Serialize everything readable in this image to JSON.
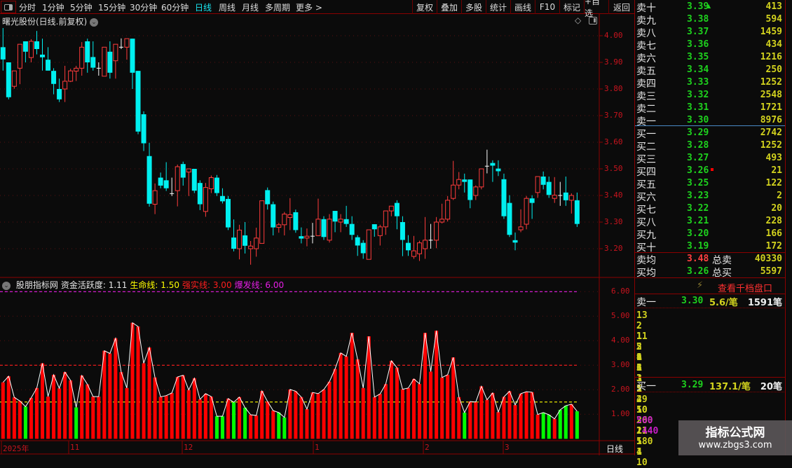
{
  "toolbar": {
    "periods": [
      "分时",
      "1分钟",
      "5分钟",
      "15分钟",
      "30分钟",
      "60分钟",
      "日线",
      "周线",
      "月线",
      "多周期",
      "更多 >"
    ],
    "active_period": "日线",
    "buttons": [
      "复权",
      "叠加",
      "多股",
      "统计",
      "画线",
      "F10",
      "标记",
      "+自选",
      "返回"
    ]
  },
  "chart": {
    "title": "曙光股份(日线.前复权)",
    "price_ticks": [
      "4.00",
      "3.90",
      "3.80",
      "3.70",
      "3.60",
      "3.50",
      "3.40",
      "3.30",
      "3.20"
    ],
    "colors": {
      "up": "#ff3c3c",
      "down": "#00f0f0",
      "doji": "#ffffff",
      "axis": "#c8141e",
      "grid": "#5a1010"
    }
  },
  "chart_data": [
    {
      "type": "candlestick",
      "ylim": [
        3.15,
        4.03
      ],
      "ohlc": [
        [
          3.957,
          4.029,
          3.869,
          3.911
        ],
        [
          3.9,
          3.9,
          3.761,
          3.769
        ],
        [
          3.81,
          3.868,
          3.801,
          3.868
        ],
        [
          3.878,
          3.968,
          3.818,
          3.968
        ],
        [
          3.979,
          3.979,
          3.9,
          3.94
        ],
        [
          3.918,
          3.987,
          3.9,
          3.979
        ],
        [
          3.979,
          4.018,
          3.93,
          3.95
        ],
        [
          3.929,
          3.989,
          3.869,
          3.919
        ],
        [
          3.91,
          3.957,
          3.869,
          3.869
        ],
        [
          3.868,
          3.878,
          3.78,
          3.819
        ],
        [
          3.8,
          3.839,
          3.751,
          3.761
        ],
        [
          3.8,
          3.887,
          3.751,
          3.829
        ],
        [
          3.829,
          3.876,
          3.826,
          3.868
        ],
        [
          3.867,
          3.887,
          3.83,
          3.878
        ],
        [
          3.878,
          3.976,
          3.85,
          3.957
        ],
        [
          3.979,
          3.989,
          3.861,
          3.9
        ],
        [
          3.92,
          3.979,
          3.869,
          3.88
        ],
        [
          3.878,
          3.9,
          3.85,
          3.878
        ],
        [
          3.848,
          3.957,
          3.848,
          3.957
        ],
        [
          3.94,
          3.979,
          3.839,
          3.861
        ],
        [
          3.906,
          3.968,
          3.839,
          3.968
        ],
        [
          3.957,
          3.99,
          3.95,
          3.957
        ],
        [
          3.957,
          3.989,
          3.91,
          3.989
        ],
        [
          3.989,
          3.989,
          3.8,
          3.861
        ],
        [
          3.868,
          3.868,
          3.63,
          3.64
        ],
        [
          3.705,
          3.716,
          3.567,
          3.596
        ],
        [
          3.548,
          3.598,
          3.358,
          3.369
        ],
        [
          3.367,
          3.445,
          3.33,
          3.418
        ],
        [
          3.467,
          3.486,
          3.427,
          3.437
        ],
        [
          3.457,
          3.525,
          3.417,
          3.427
        ],
        [
          3.407,
          3.467,
          3.398,
          3.407
        ],
        [
          3.418,
          3.516,
          3.359,
          3.508
        ],
        [
          3.518,
          3.527,
          3.437,
          3.467
        ],
        [
          3.488,
          3.5,
          3.398,
          3.5
        ],
        [
          3.5,
          3.5,
          3.409,
          3.418
        ],
        [
          3.447,
          3.457,
          3.345,
          3.367
        ],
        [
          3.34,
          3.447,
          3.32,
          3.43
        ],
        [
          3.425,
          3.475,
          3.409,
          3.467
        ],
        [
          3.467,
          3.477,
          3.398,
          3.409
        ],
        [
          3.398,
          3.427,
          3.37,
          3.378
        ],
        [
          3.387,
          3.398,
          3.27,
          3.28
        ],
        [
          3.242,
          3.31,
          3.19,
          3.2
        ],
        [
          3.2,
          3.29,
          3.16,
          3.27
        ],
        [
          3.25,
          3.3,
          3.182,
          3.211
        ],
        [
          3.2,
          3.229,
          3.14,
          3.21
        ],
        [
          3.2,
          3.279,
          3.17,
          3.24
        ],
        [
          3.22,
          3.38,
          3.22,
          3.38
        ],
        [
          3.42,
          3.43,
          3.347,
          3.367
        ],
        [
          3.367,
          3.377,
          3.25,
          3.28
        ],
        [
          3.28,
          3.297,
          3.26,
          3.29
        ],
        [
          3.29,
          3.338,
          3.25,
          3.33
        ],
        [
          3.317,
          3.39,
          3.27,
          3.328
        ],
        [
          3.337,
          3.347,
          3.26,
          3.27
        ],
        [
          3.247,
          3.28,
          3.22,
          3.238
        ],
        [
          3.24,
          3.276,
          3.209,
          3.247
        ],
        [
          3.247,
          3.297,
          3.22,
          3.247
        ],
        [
          3.249,
          3.388,
          3.249,
          3.311
        ],
        [
          3.311,
          3.322,
          3.233,
          3.244
        ],
        [
          3.232,
          3.33,
          3.223,
          3.311
        ],
        [
          3.342,
          3.342,
          3.262,
          3.302
        ],
        [
          3.3,
          3.33,
          3.262,
          3.311
        ],
        [
          3.311,
          3.361,
          3.282,
          3.293
        ],
        [
          3.293,
          3.322,
          3.233,
          3.252
        ],
        [
          3.243,
          3.251,
          3.173,
          3.212
        ],
        [
          3.222,
          3.232,
          3.162,
          3.183
        ],
        [
          3.16,
          3.271,
          3.16,
          3.271
        ],
        [
          3.292,
          3.292,
          3.245,
          3.273
        ],
        [
          3.249,
          3.29,
          3.212,
          3.282
        ],
        [
          3.282,
          3.342,
          3.252,
          3.342
        ],
        [
          3.342,
          3.36,
          3.322,
          3.36
        ],
        [
          3.372,
          3.382,
          3.273,
          3.322
        ],
        [
          3.3,
          3.322,
          3.172,
          3.233
        ],
        [
          3.222,
          3.251,
          3.173,
          3.194
        ],
        [
          3.171,
          3.248,
          3.162,
          3.192
        ],
        [
          3.181,
          3.23,
          3.154,
          3.222
        ],
        [
          3.2,
          3.319,
          3.162,
          3.232
        ],
        [
          3.232,
          3.293,
          3.2,
          3.232
        ],
        [
          3.232,
          3.319,
          3.202,
          3.3
        ],
        [
          3.3,
          3.369,
          3.295,
          3.311
        ],
        [
          3.311,
          3.398,
          3.302,
          3.382
        ],
        [
          3.389,
          3.53,
          3.383,
          3.439
        ],
        [
          3.439,
          3.488,
          3.423,
          3.46
        ],
        [
          3.46,
          3.482,
          3.411,
          3.451
        ],
        [
          3.46,
          3.46,
          3.352,
          3.383
        ],
        [
          3.4,
          3.438,
          3.383,
          3.432
        ],
        [
          3.432,
          3.5,
          3.423,
          3.5
        ],
        [
          3.51,
          3.572,
          3.483,
          3.51
        ],
        [
          3.522,
          3.532,
          3.451,
          3.512
        ],
        [
          3.501,
          3.532,
          3.473,
          3.491
        ],
        [
          3.461,
          3.482,
          3.312,
          3.322
        ],
        [
          3.372,
          3.401,
          3.244,
          3.252
        ],
        [
          3.232,
          3.261,
          3.194,
          3.223
        ],
        [
          3.271,
          3.348,
          3.262,
          3.282
        ],
        [
          3.292,
          3.398,
          3.273,
          3.389
        ],
        [
          3.389,
          3.401,
          3.312,
          3.372
        ],
        [
          3.411,
          3.471,
          3.391,
          3.471
        ],
        [
          3.471,
          3.49,
          3.423,
          3.44
        ],
        [
          3.451,
          3.471,
          3.391,
          3.402
        ],
        [
          3.389,
          3.469,
          3.372,
          3.401
        ],
        [
          3.4,
          3.451,
          3.361,
          3.4
        ],
        [
          3.411,
          3.471,
          3.361,
          3.382
        ],
        [
          3.382,
          3.408,
          3.332,
          3.4
        ],
        [
          3.382,
          3.411,
          3.282,
          3.293
        ]
      ]
    },
    {
      "type": "bar",
      "ylim": [
        0,
        6.3
      ],
      "y_ticks": [
        "6.00",
        "5.00",
        "4.00",
        "3.00",
        "2.00",
        "1.00"
      ],
      "values": [
        2.3,
        2.55,
        1.69,
        1.54,
        1.31,
        1.67,
        2.07,
        3.08,
        1.72,
        2.61,
        2.06,
        2.72,
        2.38,
        1.28,
        2.58,
        2.22,
        1.72,
        1.72,
        3.59,
        3.48,
        4.1,
        2.72,
        2.07,
        4.73,
        4.58,
        3.08,
        3.72,
        2.5,
        1.71,
        1.76,
        1.87,
        2.52,
        2.59,
        1.99,
        2.47,
        1.61,
        1.84,
        1.72,
        0.92,
        0.92,
        1.64,
        1.49,
        1.7,
        1.27,
        0.98,
        0.95,
        1.95,
        1.52,
        1.15,
        1.07,
        0.87,
        2.01,
        1.94,
        1.7,
        1.21,
        1.89,
        1.84,
        2.01,
        2.33,
        2.85,
        3.5,
        3.36,
        4.32,
        3.24,
        2.07,
        4.18,
        1.7,
        1.83,
        2.23,
        3.18,
        2.9,
        2.02,
        2.07,
        2.44,
        2.24,
        4.32,
        2.74,
        4.41,
        2.5,
        2.61,
        3.32,
        1.7,
        1.07,
        1.52,
        1.5,
        2.14,
        1.59,
        1.87,
        1.09,
        1.71,
        1.94,
        1.38,
        1.84,
        1.92,
        1.9,
        0.99,
        1.07,
        0.98,
        0.81,
        1.18,
        1.35,
        1.41,
        1.12
      ],
      "bar_colors": "RRRRGRRRRRRRRGRRRRRRRRRRRRRRRRRRRRRRRRGGRGRGRRRRRGGRRRRRRRRRRRRRRRRRRRRRRRRRRRRRRRGRRRRRRRRRRRRRGGRGGRG",
      "reference_lines": [
        {
          "name": "生命线",
          "value": 1.5,
          "color": "#ffff00"
        },
        {
          "name": "强实线",
          "value": 3.0,
          "color": "#ff1e1e"
        },
        {
          "name": "爆发线",
          "value": 6.0,
          "color": "#e61ee6"
        }
      ],
      "color_up": "#ff0000",
      "color_down": "#00ff00",
      "line_color": "#ffffff"
    }
  ],
  "indicator": {
    "name": "股朋指标网",
    "items": [
      {
        "label": "资金活跃度: 1.11",
        "color": "#e6e6e6"
      },
      {
        "label": "生命线: 1.50",
        "color": "#ffff00"
      },
      {
        "label": "强实线: 3.00",
        "color": "#ff1e1e"
      },
      {
        "label": "爆发线: 6.00",
        "color": "#e61ee6"
      }
    ]
  },
  "date_axis": {
    "labels": [
      "2025年",
      "11",
      "12",
      "1",
      "2",
      "3"
    ],
    "period": "日线"
  },
  "orderbook": {
    "asks": [
      {
        "label": "卖十",
        "price": "3.39",
        "vol": "413"
      },
      {
        "label": "卖九",
        "price": "3.38",
        "vol": "594"
      },
      {
        "label": "卖八",
        "price": "3.37",
        "vol": "1459"
      },
      {
        "label": "卖七",
        "price": "3.36",
        "vol": "434"
      },
      {
        "label": "卖六",
        "price": "3.35",
        "vol": "1216"
      },
      {
        "label": "卖五",
        "price": "3.34",
        "vol": "250"
      },
      {
        "label": "卖四",
        "price": "3.33",
        "vol": "1252"
      },
      {
        "label": "卖三",
        "price": "3.32",
        "vol": "2548"
      },
      {
        "label": "卖二",
        "price": "3.31",
        "vol": "1721"
      },
      {
        "label": "卖一",
        "price": "3.30",
        "vol": "8976"
      }
    ],
    "bids": [
      {
        "label": "买一",
        "price": "3.29",
        "vol": "2742"
      },
      {
        "label": "买二",
        "price": "3.28",
        "vol": "1252"
      },
      {
        "label": "买三",
        "price": "3.27",
        "vol": "493"
      },
      {
        "label": "买四",
        "price": "3.26",
        "vol": "21"
      },
      {
        "label": "买五",
        "price": "3.25",
        "vol": "122"
      },
      {
        "label": "买六",
        "price": "3.23",
        "vol": "2"
      },
      {
        "label": "买七",
        "price": "3.22",
        "vol": "20"
      },
      {
        "label": "买八",
        "price": "3.21",
        "vol": "228"
      },
      {
        "label": "买九",
        "price": "3.20",
        "vol": "166"
      },
      {
        "label": "买十",
        "price": "3.19",
        "vol": "172"
      }
    ],
    "avg_ask": {
      "label": "卖均",
      "price": "3.48",
      "total_label": "总卖",
      "total": "40330"
    },
    "avg_bid": {
      "label": "买均",
      "price": "3.26",
      "total_label": "总买",
      "total": "5597"
    }
  },
  "depth": {
    "link": "查看千档盘口",
    "ask1": {
      "label": "卖一",
      "price": "3.30",
      "per": "5.6/笔",
      "count": "1591笔",
      "rows": [
        [
          "13",
          "2",
          "1",
          "2",
          "9"
        ],
        [
          "2",
          "11",
          "2",
          "4",
          "3"
        ],
        [
          "1",
          "5",
          "1",
          "1",
          "1"
        ],
        [
          "2",
          "1",
          "1",
          "3",
          "5"
        ],
        [
          "1",
          "6",
          "1",
          "1",
          "2"
        ],
        [
          "3",
          "3",
          "1",
          "2",
          "1"
        ]
      ]
    },
    "bid1": {
      "label": "买一",
      "price": "3.29",
      "per": "137.1/笔",
      "count": "20笔",
      "rows": [
        [
          "49",
          "50",
          "200",
          "11",
          "1"
        ],
        [
          "10",
          "26",
          "1440",
          "180",
          "1"
        ],
        [
          "500",
          "1",
          "5",
          "4",
          "10"
        ],
        [
          "2",
          "",
          "",
          "",
          ""
        ]
      ],
      "large": [
        "1440",
        "500"
      ]
    }
  },
  "watermark": {
    "title": "指标公式网",
    "url": "www.zbgs3.com"
  }
}
